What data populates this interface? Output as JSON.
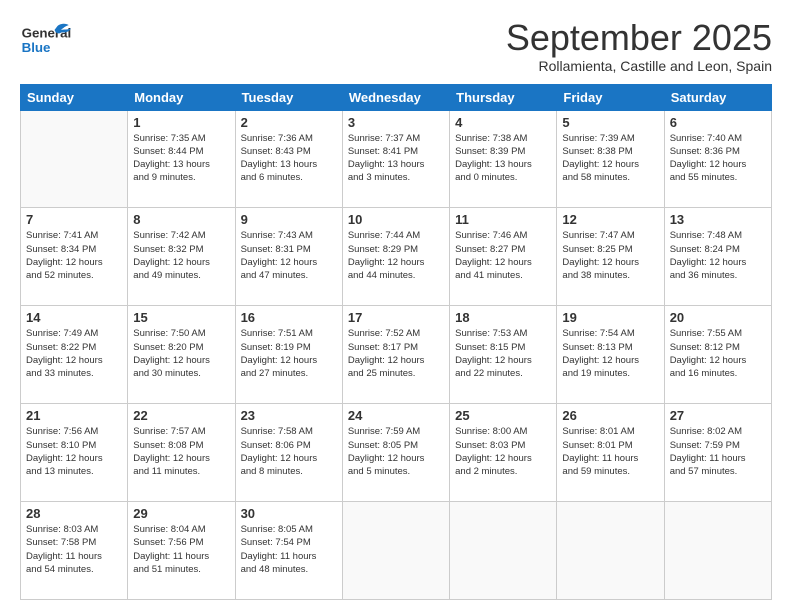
{
  "header": {
    "logo_line1": "General",
    "logo_line2": "Blue",
    "month": "September 2025",
    "location": "Rollamienta, Castille and Leon, Spain"
  },
  "days_of_week": [
    "Sunday",
    "Monday",
    "Tuesday",
    "Wednesday",
    "Thursday",
    "Friday",
    "Saturday"
  ],
  "weeks": [
    [
      {
        "day": "",
        "info": ""
      },
      {
        "day": "1",
        "info": "Sunrise: 7:35 AM\nSunset: 8:44 PM\nDaylight: 13 hours\nand 9 minutes."
      },
      {
        "day": "2",
        "info": "Sunrise: 7:36 AM\nSunset: 8:43 PM\nDaylight: 13 hours\nand 6 minutes."
      },
      {
        "day": "3",
        "info": "Sunrise: 7:37 AM\nSunset: 8:41 PM\nDaylight: 13 hours\nand 3 minutes."
      },
      {
        "day": "4",
        "info": "Sunrise: 7:38 AM\nSunset: 8:39 PM\nDaylight: 13 hours\nand 0 minutes."
      },
      {
        "day": "5",
        "info": "Sunrise: 7:39 AM\nSunset: 8:38 PM\nDaylight: 12 hours\nand 58 minutes."
      },
      {
        "day": "6",
        "info": "Sunrise: 7:40 AM\nSunset: 8:36 PM\nDaylight: 12 hours\nand 55 minutes."
      }
    ],
    [
      {
        "day": "7",
        "info": "Sunrise: 7:41 AM\nSunset: 8:34 PM\nDaylight: 12 hours\nand 52 minutes."
      },
      {
        "day": "8",
        "info": "Sunrise: 7:42 AM\nSunset: 8:32 PM\nDaylight: 12 hours\nand 49 minutes."
      },
      {
        "day": "9",
        "info": "Sunrise: 7:43 AM\nSunset: 8:31 PM\nDaylight: 12 hours\nand 47 minutes."
      },
      {
        "day": "10",
        "info": "Sunrise: 7:44 AM\nSunset: 8:29 PM\nDaylight: 12 hours\nand 44 minutes."
      },
      {
        "day": "11",
        "info": "Sunrise: 7:46 AM\nSunset: 8:27 PM\nDaylight: 12 hours\nand 41 minutes."
      },
      {
        "day": "12",
        "info": "Sunrise: 7:47 AM\nSunset: 8:25 PM\nDaylight: 12 hours\nand 38 minutes."
      },
      {
        "day": "13",
        "info": "Sunrise: 7:48 AM\nSunset: 8:24 PM\nDaylight: 12 hours\nand 36 minutes."
      }
    ],
    [
      {
        "day": "14",
        "info": "Sunrise: 7:49 AM\nSunset: 8:22 PM\nDaylight: 12 hours\nand 33 minutes."
      },
      {
        "day": "15",
        "info": "Sunrise: 7:50 AM\nSunset: 8:20 PM\nDaylight: 12 hours\nand 30 minutes."
      },
      {
        "day": "16",
        "info": "Sunrise: 7:51 AM\nSunset: 8:19 PM\nDaylight: 12 hours\nand 27 minutes."
      },
      {
        "day": "17",
        "info": "Sunrise: 7:52 AM\nSunset: 8:17 PM\nDaylight: 12 hours\nand 25 minutes."
      },
      {
        "day": "18",
        "info": "Sunrise: 7:53 AM\nSunset: 8:15 PM\nDaylight: 12 hours\nand 22 minutes."
      },
      {
        "day": "19",
        "info": "Sunrise: 7:54 AM\nSunset: 8:13 PM\nDaylight: 12 hours\nand 19 minutes."
      },
      {
        "day": "20",
        "info": "Sunrise: 7:55 AM\nSunset: 8:12 PM\nDaylight: 12 hours\nand 16 minutes."
      }
    ],
    [
      {
        "day": "21",
        "info": "Sunrise: 7:56 AM\nSunset: 8:10 PM\nDaylight: 12 hours\nand 13 minutes."
      },
      {
        "day": "22",
        "info": "Sunrise: 7:57 AM\nSunset: 8:08 PM\nDaylight: 12 hours\nand 11 minutes."
      },
      {
        "day": "23",
        "info": "Sunrise: 7:58 AM\nSunset: 8:06 PM\nDaylight: 12 hours\nand 8 minutes."
      },
      {
        "day": "24",
        "info": "Sunrise: 7:59 AM\nSunset: 8:05 PM\nDaylight: 12 hours\nand 5 minutes."
      },
      {
        "day": "25",
        "info": "Sunrise: 8:00 AM\nSunset: 8:03 PM\nDaylight: 12 hours\nand 2 minutes."
      },
      {
        "day": "26",
        "info": "Sunrise: 8:01 AM\nSunset: 8:01 PM\nDaylight: 11 hours\nand 59 minutes."
      },
      {
        "day": "27",
        "info": "Sunrise: 8:02 AM\nSunset: 7:59 PM\nDaylight: 11 hours\nand 57 minutes."
      }
    ],
    [
      {
        "day": "28",
        "info": "Sunrise: 8:03 AM\nSunset: 7:58 PM\nDaylight: 11 hours\nand 54 minutes."
      },
      {
        "day": "29",
        "info": "Sunrise: 8:04 AM\nSunset: 7:56 PM\nDaylight: 11 hours\nand 51 minutes."
      },
      {
        "day": "30",
        "info": "Sunrise: 8:05 AM\nSunset: 7:54 PM\nDaylight: 11 hours\nand 48 minutes."
      },
      {
        "day": "",
        "info": ""
      },
      {
        "day": "",
        "info": ""
      },
      {
        "day": "",
        "info": ""
      },
      {
        "day": "",
        "info": ""
      }
    ]
  ]
}
